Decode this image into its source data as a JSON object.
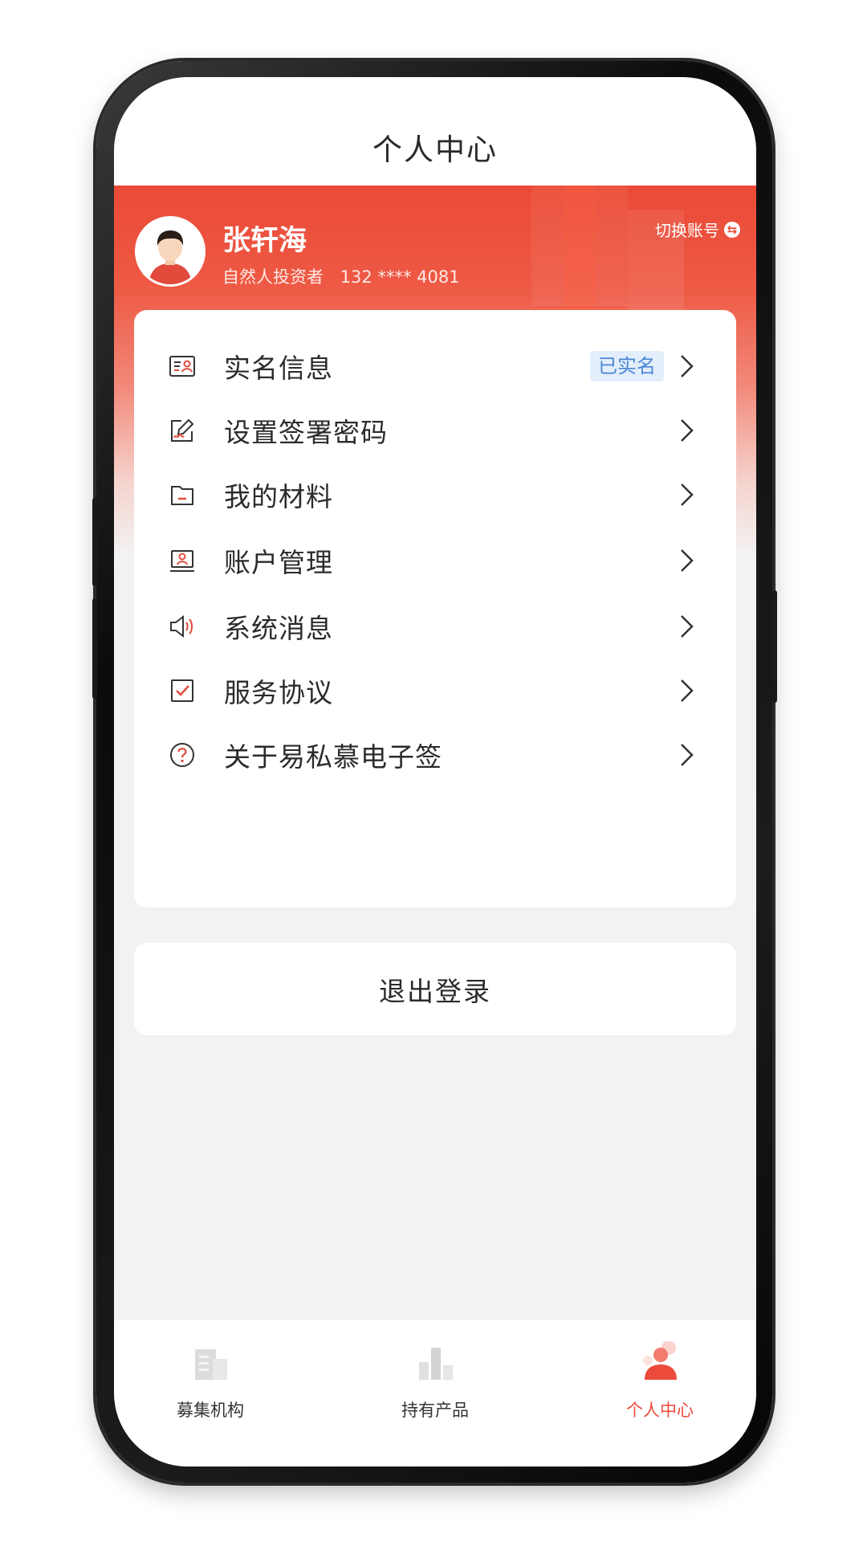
{
  "nav": {
    "title": "个人中心"
  },
  "profile": {
    "name": "张轩海",
    "role": "自然人投资者",
    "phone": "132 **** 4081",
    "switch_label": "切换账号",
    "avatar_icon": "avatar-man"
  },
  "menu": {
    "items": [
      {
        "label": "实名信息",
        "icon": "id-card-icon",
        "badge": "已实名"
      },
      {
        "label": "设置签署密码",
        "icon": "signature-edit-icon"
      },
      {
        "label": "我的材料",
        "icon": "folder-icon"
      },
      {
        "label": "账户管理",
        "icon": "account-card-icon"
      },
      {
        "label": "系统消息",
        "icon": "speaker-icon"
      },
      {
        "label": "服务协议",
        "icon": "checkbox-icon"
      },
      {
        "label": "关于易私慕电子签",
        "icon": "question-circle-icon"
      }
    ]
  },
  "logout_label": "退出登录",
  "tabbar": {
    "tabs": [
      {
        "label": "募集机构",
        "icon": "building-icon",
        "active": false
      },
      {
        "label": "持有产品",
        "icon": "bar-chart-icon",
        "active": false
      },
      {
        "label": "个人中心",
        "icon": "person-icon",
        "active": true
      }
    ]
  },
  "colors": {
    "brand_red": "#ea4a36",
    "badge_blue": "#4a86d6",
    "badge_bg": "#e3eefb"
  }
}
